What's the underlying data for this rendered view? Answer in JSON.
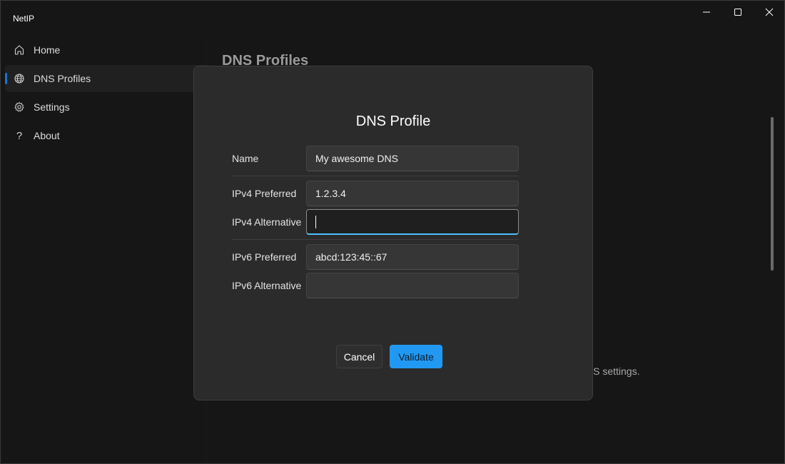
{
  "window": {
    "title": "NetIP",
    "controls": {
      "minimize": "minimize",
      "maximize": "maximize",
      "close": "close"
    }
  },
  "sidebar": {
    "items": [
      {
        "label": "Home",
        "icon": "home-icon",
        "selected": false
      },
      {
        "label": "DNS Profiles",
        "icon": "globe-icon",
        "selected": true
      },
      {
        "label": "Settings",
        "icon": "gear-icon",
        "selected": false
      },
      {
        "label": "About",
        "icon": "question-icon",
        "selected": false
      }
    ]
  },
  "page": {
    "title": "DNS Profiles",
    "partial_text": "NS settings."
  },
  "dialog": {
    "title": "DNS Profile",
    "fields": [
      {
        "label": "Name",
        "value": "My awesome DNS",
        "focused": false
      },
      {
        "label": "IPv4 Preferred",
        "value": "1.2.3.4",
        "focused": false
      },
      {
        "label": "IPv4 Alternative",
        "value": "",
        "focused": true
      },
      {
        "label": "IPv6 Preferred",
        "value": "abcd:123:45::67",
        "focused": false
      },
      {
        "label": "IPv6 Alternative",
        "value": "",
        "focused": false
      }
    ],
    "buttons": {
      "cancel": "Cancel",
      "validate": "Validate"
    }
  },
  "colors": {
    "accent": "#2199f3",
    "selection_indicator": "#1a74d1",
    "focus_underline": "#4cc2ff",
    "background": "#161616",
    "dialog_background": "#2b2b2b"
  }
}
